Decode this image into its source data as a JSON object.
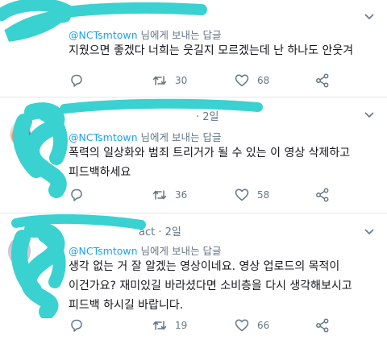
{
  "colors": {
    "accent": "#1da1f2",
    "text": "#14171a",
    "muted": "#657786",
    "divider": "#e1e8ed",
    "scribble": "#3ad1d1",
    "retweet": "#657786"
  },
  "tweets": [
    {
      "time_label": "",
      "reply_to": "@NCTsmtown",
      "reply_suffix": " 님에게 보내는 답글",
      "lines": [
        "지웠으면 좋겠다 너희는 웃길지 모르겠는데 난 하나도 안웃겨"
      ],
      "retweets": "30",
      "likes": "68",
      "icons": {
        "reply": "reply-icon",
        "retweet": "retweet-icon",
        "like": "heart-icon",
        "share": "share-icon",
        "more": "chevron-down-icon"
      }
    },
    {
      "time_label": "· 2일",
      "reply_to": "@NCTsmtown",
      "reply_suffix": " 님에게 보내는 답글",
      "lines": [
        "폭력의 일상화와 범죄 트리거가 될 수 있는 이 영상 삭제하고",
        "피드백하세요"
      ],
      "retweets": "36",
      "likes": "58",
      "icons": {
        "reply": "reply-icon",
        "retweet": "retweet-icon",
        "like": "heart-icon",
        "share": "share-icon",
        "more": "chevron-down-icon"
      }
    },
    {
      "time_label": "act · 2일",
      "reply_to": "@NCTsmtown",
      "reply_suffix": " 님에게 보내는 답글",
      "lines": [
        "생각 없는 거 잘 알겠는 영상이네요. 영상 업로드의 목적이",
        "이건가요? 재미있길 바라셨다면 소비층을 다시 생각해보시고",
        "피드백 하시길 바랍니다."
      ],
      "retweets": "19",
      "likes": "66",
      "icons": {
        "reply": "reply-icon",
        "retweet": "retweet-icon",
        "like": "heart-icon",
        "share": "share-icon",
        "more": "chevron-down-icon"
      }
    }
  ]
}
